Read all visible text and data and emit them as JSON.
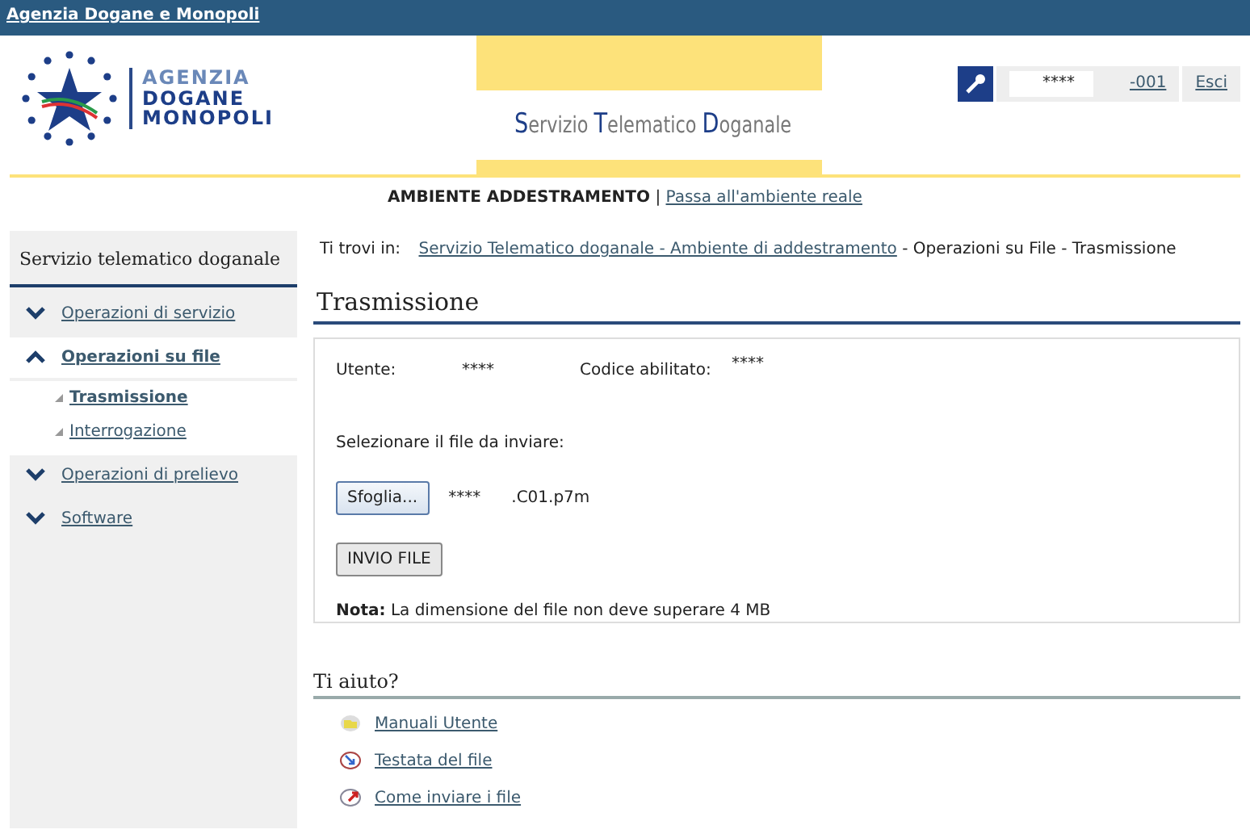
{
  "top_bar": {
    "link": "Agenzia Dogane e Monopoli"
  },
  "logo": {
    "lines": [
      "AGENZIA",
      "DOGANE",
      "MONOPOLI"
    ]
  },
  "service_logo": {
    "words": [
      "Servizio",
      "Telematico",
      "Doganale"
    ]
  },
  "user": {
    "name": "****",
    "code": "-001",
    "logout": "Esci"
  },
  "environment": {
    "label": "AMBIENTE ADDESTRAMENTO",
    "separator": "|",
    "link": "Passa all'ambiente reale"
  },
  "sidebar": {
    "title": "Servizio telematico doganale",
    "items": [
      {
        "label": "Operazioni di servizio",
        "expanded": false,
        "selected": false
      },
      {
        "label": "Operazioni su file",
        "expanded": true,
        "selected": true,
        "children": [
          {
            "label": "Trasmissione",
            "selected": true
          },
          {
            "label": "Interrogazione",
            "selected": false
          }
        ]
      },
      {
        "label": "Operazioni di prelievo",
        "expanded": false,
        "selected": false
      },
      {
        "label": "Software",
        "expanded": false,
        "selected": false
      }
    ]
  },
  "breadcrumb": {
    "label": "Ti trovi in:",
    "items": [
      {
        "text": "Servizio Telematico doganale - Ambiente di addestramento",
        "kind": "link"
      },
      {
        "text": "- Operazioni su File",
        "kind": "text"
      },
      {
        "text": "- Trasmissione",
        "kind": "text"
      }
    ]
  },
  "page_title": "Trasmissione",
  "form": {
    "user_label": "Utente:",
    "user_value": "****",
    "code_label": "Codice abilitato:",
    "code_value": "****",
    "file_prompt": "Selezionare il file da inviare:",
    "browse_button": "Sfoglia...",
    "file_name": [
      "****",
      ".C01.p7m"
    ],
    "submit_button": "INVIO FILE",
    "note": "**Nota:** La dimensione del file non deve superare 4 MB"
  },
  "help": {
    "title": "Ti aiuto?",
    "links": [
      {
        "label": "Manuali Utente",
        "kind": "folder"
      },
      {
        "label": "Testata del file",
        "kind": "arrow-in"
      },
      {
        "label": "Come inviare i file",
        "kind": "arrow-out"
      }
    ]
  }
}
